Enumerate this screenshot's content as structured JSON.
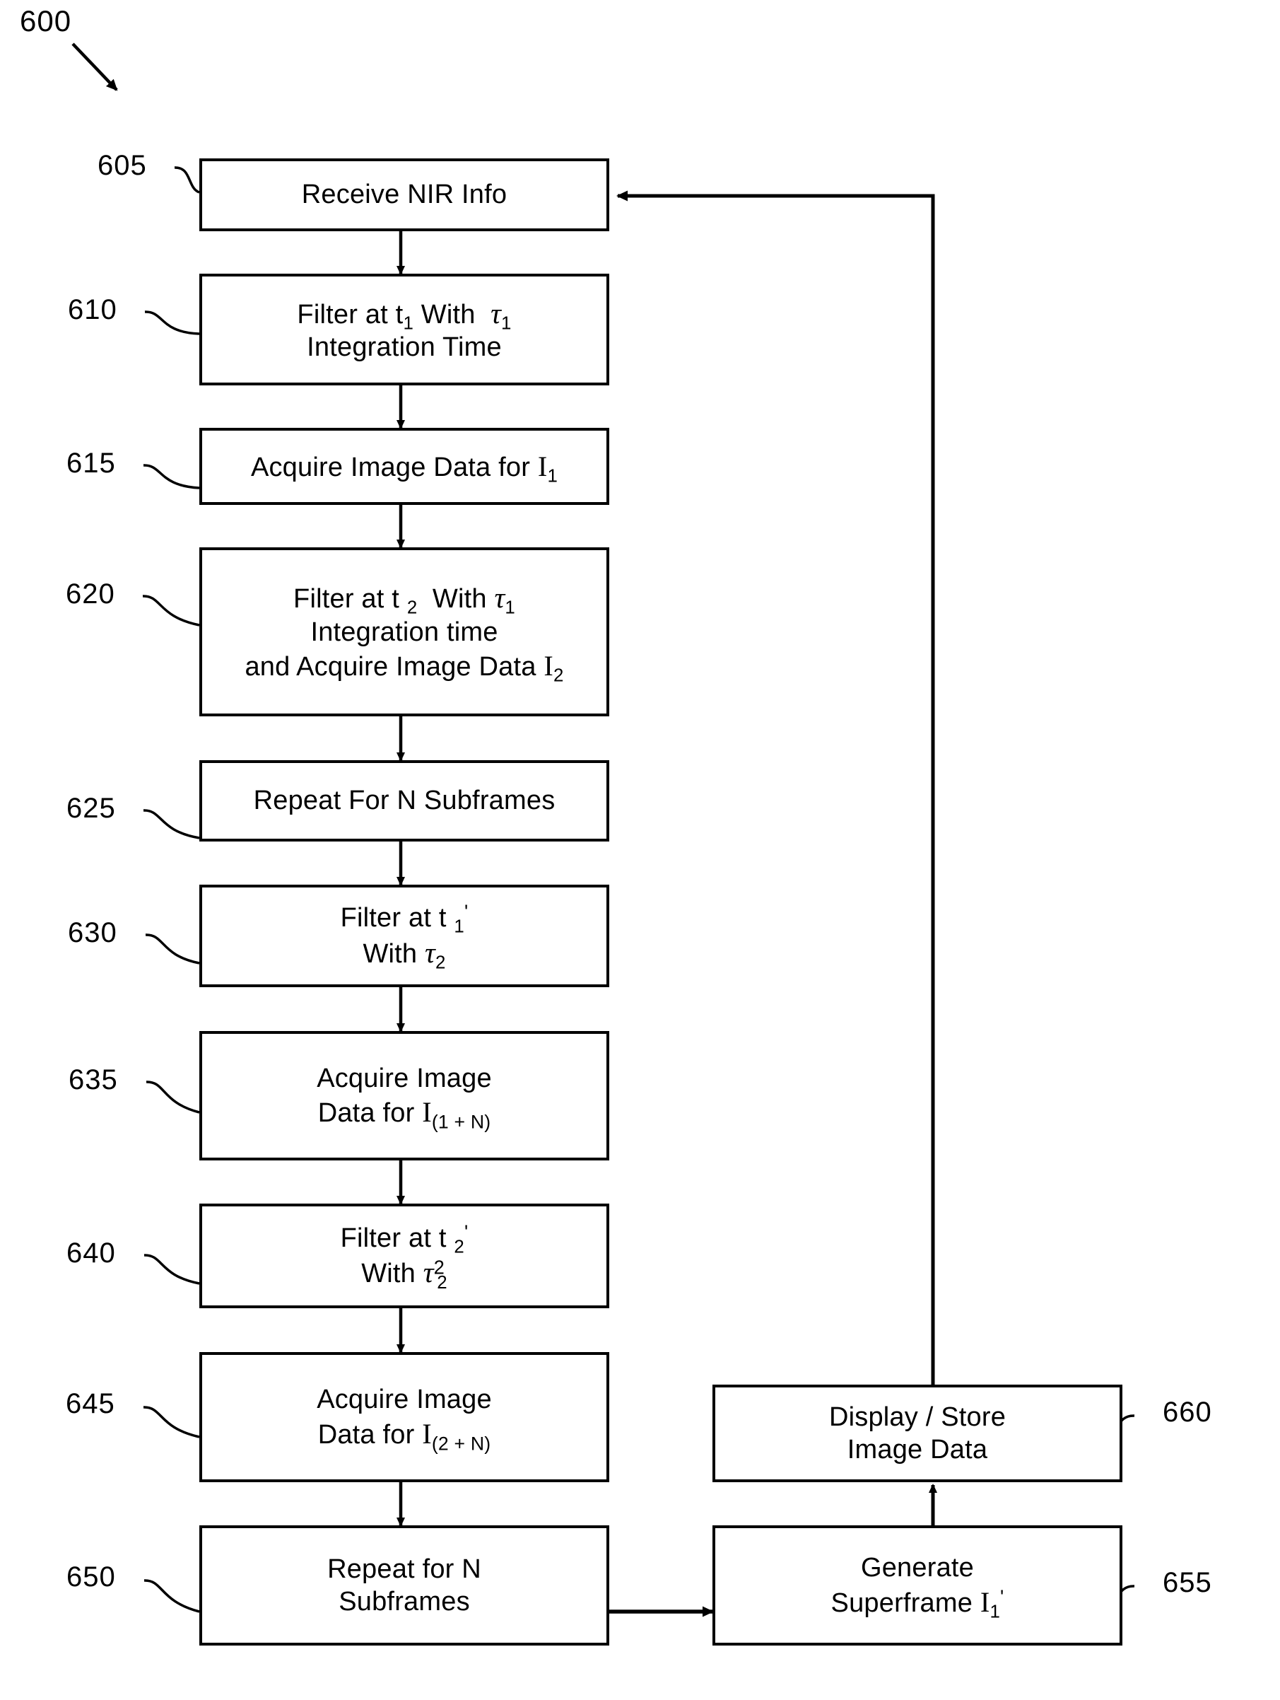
{
  "figure": {
    "label": "600",
    "type": "patent-flowchart"
  },
  "nodes": [
    {
      "ref": "605",
      "name": "receive-nir-info",
      "lines": [
        "Receive NIR Info"
      ]
    },
    {
      "ref": "610",
      "name": "filter-t1-tau1",
      "lines": [
        "Filter at t1 With τ1",
        "Integration Time"
      ]
    },
    {
      "ref": "615",
      "name": "acquire-image-data-i1",
      "lines": [
        "Acquire Image Data for I1"
      ]
    },
    {
      "ref": "620",
      "name": "filter-t2-tau1-acquire-i2",
      "lines": [
        "Filter at t2  With τ1",
        "Integration time",
        "and Acquire Image Data I2"
      ]
    },
    {
      "ref": "625",
      "name": "repeat-for-n-subframes",
      "lines": [
        "Repeat For N Subframes"
      ]
    },
    {
      "ref": "630",
      "name": "filter-t1prime-tau2",
      "lines": [
        "Filter at t1'",
        "With τ2"
      ]
    },
    {
      "ref": "635",
      "name": "acquire-image-data-i1plusn",
      "lines": [
        "Acquire Image",
        "Data for I(1 + N)"
      ]
    },
    {
      "ref": "640",
      "name": "filter-t2prime-tau2",
      "lines": [
        "Filter at t2'",
        "With τ2"
      ]
    },
    {
      "ref": "645",
      "name": "acquire-image-data-i2plusn",
      "lines": [
        "Acquire Image",
        "Data for I(2 + N)"
      ]
    },
    {
      "ref": "650",
      "name": "repeat-for-n-subframes-2",
      "lines": [
        "Repeat for N",
        "Subframes"
      ]
    },
    {
      "ref": "655",
      "name": "generate-superframe",
      "lines": [
        "Generate",
        "Superframe I1'"
      ]
    },
    {
      "ref": "660",
      "name": "display-store-image-data",
      "lines": [
        "Display / Store",
        "Image Data"
      ]
    }
  ],
  "node_text": {
    "n605_l1": "Receive NIR Info",
    "n610_l1_a": "Filter at t",
    "n610_l1_sub1": "1",
    "n610_l1_b": "With",
    "n610_l1_tau": "τ",
    "n610_l1_sub2": "1",
    "n610_l2": "Integration Time",
    "n615_l1_a": "Acquire Image Data for",
    "n615_l1_i": "I",
    "n615_l1_sub": "1",
    "n620_l1_a": "Filter at t",
    "n620_l1_sub1": "2",
    "n620_l1_b": "With",
    "n620_l1_tau": "τ",
    "n620_l1_sub2": "1",
    "n620_l2": "Integration time",
    "n620_l3_a": "and Acquire Image Data",
    "n620_l3_i": "I",
    "n620_l3_sub": "2",
    "n625_l1": "Repeat For N Subframes",
    "n630_l1_a": "Filter at t",
    "n630_l1_sub": "1",
    "n630_l1_prime": "'",
    "n630_l2_a": "With",
    "n630_l2_tau": "τ",
    "n630_l2_sub": "2",
    "n635_l1": "Acquire Image",
    "n635_l2_a": "Data for",
    "n635_l2_i": "I",
    "n635_l2_sub": "(1 + N)",
    "n640_l1_a": "Filter at t",
    "n640_l1_sub": "2",
    "n640_l1_prime": "'",
    "n640_l1_sup": "2",
    "n640_l2_a": "With",
    "n640_l2_tau": "τ",
    "n640_l2_sub": "2",
    "n645_l1": "Acquire Image",
    "n645_l2_a": "Data for",
    "n645_l2_i": "I",
    "n645_l2_sub": "(2 + N)",
    "n650_l1": "Repeat for N",
    "n650_l2": "Subframes",
    "n655_l1": "Generate",
    "n655_l2_a": "Superframe",
    "n655_l2_i": "I",
    "n655_l2_sub": "1",
    "n655_l2_prime": "'",
    "n660_l1": "Display / Store",
    "n660_l2": "Image Data"
  },
  "refs": {
    "fig": "600",
    "r605": "605",
    "r610": "610",
    "r615": "615",
    "r620": "620",
    "r625": "625",
    "r630": "630",
    "r635": "635",
    "r640": "640",
    "r645": "645",
    "r650": "650",
    "r655": "655",
    "r660": "660"
  },
  "colors": {
    "stroke": "#000000",
    "fill": "#ffffff",
    "text": "#000000"
  }
}
